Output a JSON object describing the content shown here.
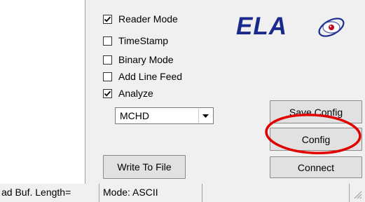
{
  "checkboxes": [
    {
      "label": "Reader Mode",
      "checked": true
    },
    {
      "label": "TimeStamp",
      "checked": false
    },
    {
      "label": "Binary Mode",
      "checked": false
    },
    {
      "label": "Add Line Feed",
      "checked": false
    },
    {
      "label": "Analyze",
      "checked": true
    }
  ],
  "mode_select": {
    "value": "MCHD"
  },
  "buttons": {
    "save_config": "Save Config",
    "config": "Config",
    "connect": "Connect",
    "write_to_file": "Write To File"
  },
  "logo": {
    "text": "ELA",
    "icon": "eye-orbit-icon"
  },
  "status_bar": {
    "buf_length": "ad Buf. Length=",
    "mode": "Mode: ASCII",
    "extra": ""
  },
  "colors": {
    "logo_text": "#1a2a8c",
    "annotation": "#e00000",
    "dialog_bg": "#f0f0f0",
    "button_bg": "#e1e1e1"
  }
}
